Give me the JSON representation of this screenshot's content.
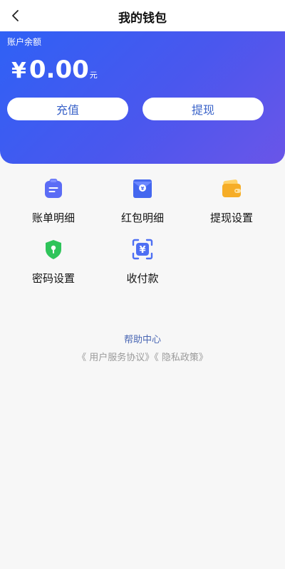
{
  "header": {
    "title": "我的钱包"
  },
  "wallet": {
    "balance_label": "账户余额",
    "currency_symbol": "¥",
    "amount": "0.00",
    "unit": "元",
    "recharge_label": "充值",
    "withdraw_label": "提现",
    "gradient_colors": [
      "#2f61f5",
      "#6a55e8"
    ]
  },
  "menu": {
    "items": [
      {
        "label": "账单明细",
        "icon": "bill-clipboard-icon",
        "color": "#5b6cf5"
      },
      {
        "label": "红包明细",
        "icon": "red-packet-icon",
        "color": "#4467ef"
      },
      {
        "label": "提现设置",
        "icon": "wallet-card-icon",
        "color": "#f6ad27"
      },
      {
        "label": "密码设置",
        "icon": "shield-lock-icon",
        "color": "#2fc45a"
      },
      {
        "label": "收付款",
        "icon": "scan-yuan-icon",
        "color": "#4e6ff3"
      }
    ]
  },
  "footer": {
    "help_label": "帮助中心",
    "user_agreement": "《 用户服务协议》",
    "privacy_policy": "《 隐私政策》"
  }
}
